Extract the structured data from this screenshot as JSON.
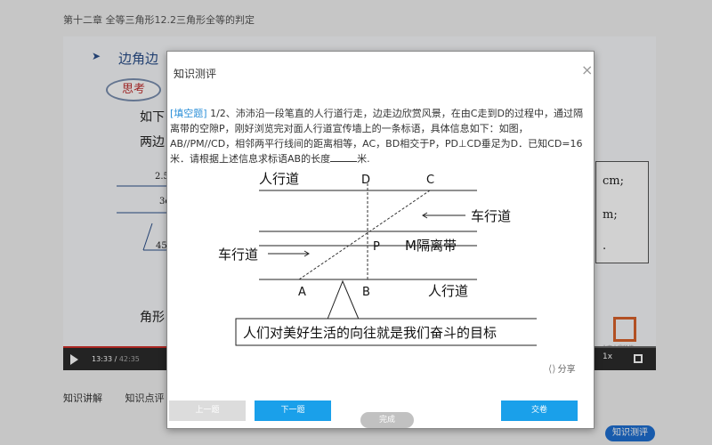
{
  "page": {
    "chapter_title": "第十二章 全等三角形12.2三角形全等的判定",
    "slide": {
      "heading": "边角边",
      "think_label": "思考",
      "text1": "如下",
      "text2": "两边",
      "labels": [
        "2.5",
        "3c",
        "45"
      ],
      "right_texts": [
        "cm;",
        "m;",
        "."
      ],
      "bottom_text": "角形",
      "logo_sub": "北京本鼎科技"
    },
    "player": {
      "time_current": "13:33",
      "time_total": "42:35",
      "progress": 0.32,
      "speed": "1x"
    },
    "tabs": [
      "知识讲解",
      "知识点评"
    ],
    "fab_label": "知识测评"
  },
  "modal": {
    "title": "知识测评",
    "question": {
      "type_label": "[填空题]",
      "text": " 1/2、沛沛沿一段笔直的人行道行走，边走边欣赏风景，在由C走到D的过程中，通过隔离带的空隙P，刚好浏览完对面人行道宣传墙上的一条标语，具体信息如下：如图，AB//PM//CD，相邻两平行线间的距离相等，AC，BD相交于P，PD⊥CD垂足为D．已知CD=16米．请根据上述信息求标语AB的长度",
      "text_end": "米."
    },
    "figure": {
      "top_road": "人行道",
      "bottom_road": "人行道",
      "right_lane": "车行道",
      "left_lane": "车行道",
      "median": "M隔离带",
      "point_d": "D",
      "point_c": "C",
      "point_p": "P",
      "point_a": "A",
      "point_b": "B",
      "slogan": "人们对美好生活的向往就是我们奋斗的目标"
    },
    "share_label": "分享",
    "buttons": {
      "prev": "上一题",
      "next": "下一题",
      "submit": "交卷"
    },
    "under_button": "完成"
  }
}
